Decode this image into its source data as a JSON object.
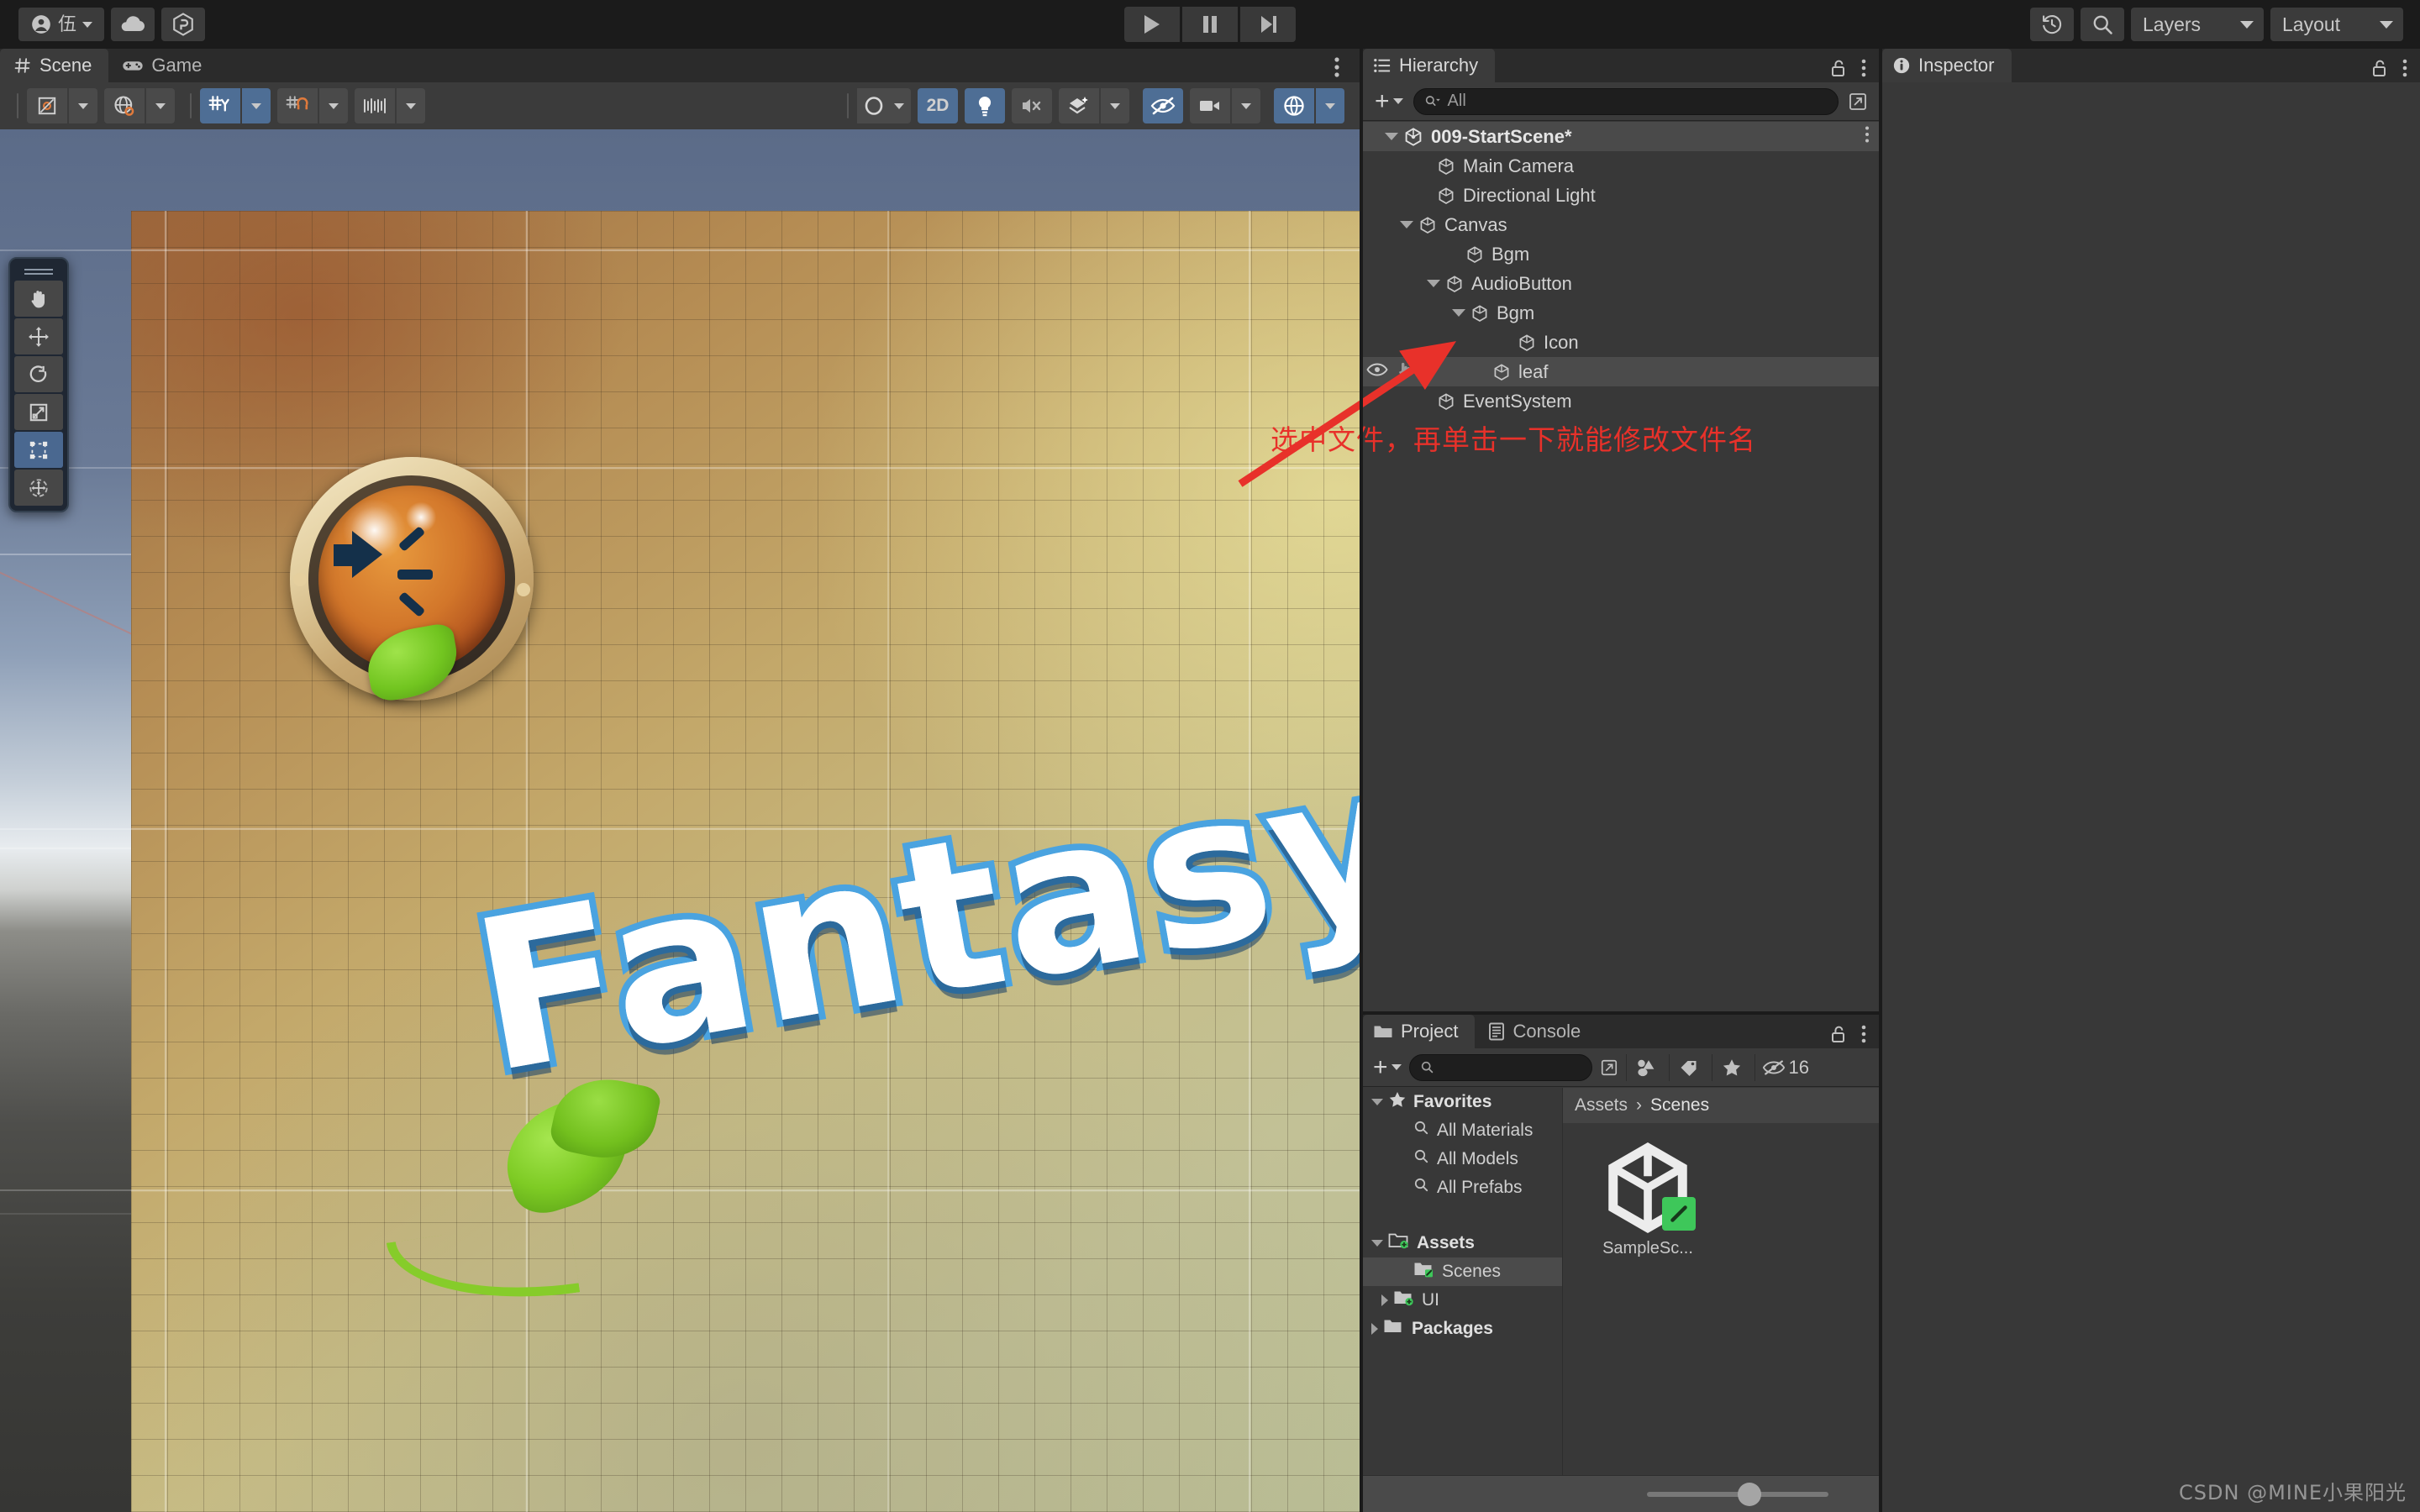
{
  "toolbar": {
    "account_label": "伍",
    "account_icon": "user-circle-icon",
    "cloud_icon": "cloud-icon",
    "services_icon": "unity-services-icon",
    "play_icon": "play-icon",
    "pause_icon": "pause-icon",
    "step_icon": "step-forward-icon",
    "history_icon": "undo-history-icon",
    "search_icon": "search-icon",
    "layers_label": "Layers",
    "layout_label": "Layout"
  },
  "scene_panel": {
    "tabs": [
      {
        "label": "Scene",
        "icon": "grid-hash-icon",
        "active": true
      },
      {
        "label": "Game",
        "icon": "gamepad-icon",
        "active": false
      }
    ],
    "kebab_icon": "kebab-menu-icon",
    "toolbar_left": [
      {
        "name": "pivot-mode",
        "icon": "pivot-center-icon",
        "dropdown": true,
        "active": false
      },
      {
        "name": "handle-space",
        "icon": "global-local-icon",
        "dropdown": true,
        "active": false
      }
    ],
    "toolbar_grid": [
      {
        "name": "grid-axis",
        "icon": "grid-y-icon",
        "dropdown": true,
        "active": true
      },
      {
        "name": "grid-snapping",
        "icon": "grid-snap-magnet-icon",
        "dropdown": true,
        "active": false
      },
      {
        "name": "snap-increment",
        "icon": "snap-ruler-icon",
        "dropdown": true,
        "active": false
      }
    ],
    "toolbar_right": [
      {
        "name": "shading-mode",
        "icon": "shaded-sphere-icon",
        "dropdown": true,
        "active": false
      },
      {
        "name": "2d-toggle",
        "label": "2D",
        "active": true
      },
      {
        "name": "scene-lighting",
        "icon": "lightbulb-icon",
        "active": true
      },
      {
        "name": "scene-audio",
        "icon": "speaker-mute-icon",
        "active": false
      },
      {
        "name": "effects",
        "icon": "fx-layers-icon",
        "dropdown": true,
        "active": false
      },
      {
        "name": "scene-visibility",
        "icon": "eye-off-icon",
        "active": true
      },
      {
        "name": "scene-camera",
        "icon": "camera-icon",
        "dropdown": true,
        "active": false
      },
      {
        "name": "gizmos",
        "icon": "gizmo-globe-icon",
        "dropdown": true,
        "active": true
      }
    ],
    "tool_palette": [
      {
        "name": "hand-tool",
        "icon": "hand-icon",
        "active": false
      },
      {
        "name": "move-tool",
        "icon": "move-arrows-icon",
        "active": false
      },
      {
        "name": "rotate-tool",
        "icon": "rotate-icon",
        "active": false
      },
      {
        "name": "scale-tool",
        "icon": "scale-icon",
        "active": false
      },
      {
        "name": "rect-tool",
        "icon": "rect-transform-icon",
        "active": true
      },
      {
        "name": "transform-tool",
        "icon": "transform-combined-icon",
        "active": false
      }
    ],
    "game_art": {
      "title_text": "Fantasy G",
      "audio_button": "audio-speaker-button-art",
      "leaf": "leaf-art"
    }
  },
  "hierarchy": {
    "tab_label": "Hierarchy",
    "tab_icon": "hierarchy-list-icon",
    "lock_icon": "lock-open-icon",
    "kebab_icon": "kebab-menu-icon",
    "add_label": "+",
    "search_placeholder": "All",
    "search_value": "",
    "search_icon": "search-dropdown-icon",
    "expand_icon": "open-in-new-icon",
    "items": [
      {
        "label": "009-StartScene*",
        "depth": 0,
        "icon": "unity-scene-icon",
        "expanded": true,
        "root": true,
        "selected": false,
        "kebab": true
      },
      {
        "label": "Main Camera",
        "depth": 1,
        "icon": "gameobject-cube-icon",
        "expanded": null,
        "selected": false
      },
      {
        "label": "Directional Light",
        "depth": 1,
        "icon": "gameobject-cube-icon",
        "expanded": null,
        "selected": false
      },
      {
        "label": "Canvas",
        "depth": 1,
        "icon": "gameobject-cube-icon",
        "expanded": true,
        "selected": false
      },
      {
        "label": "Bgm",
        "depth": 2,
        "icon": "gameobject-cube-icon",
        "expanded": null,
        "selected": false
      },
      {
        "label": "AudioButton",
        "depth": 2,
        "icon": "gameobject-cube-icon",
        "expanded": true,
        "selected": false
      },
      {
        "label": "Bgm",
        "depth": 3,
        "icon": "gameobject-cube-icon",
        "expanded": true,
        "selected": false
      },
      {
        "label": "Icon",
        "depth": 4,
        "icon": "gameobject-cube-icon",
        "expanded": null,
        "selected": false
      },
      {
        "label": "leaf",
        "depth": 3,
        "icon": "gameobject-cube-icon",
        "expanded": null,
        "selected": true,
        "visibility_icons": true
      },
      {
        "label": "EventSystem",
        "depth": 1,
        "icon": "gameobject-cube-icon",
        "expanded": null,
        "selected": false
      }
    ]
  },
  "inspector": {
    "tab_label": "Inspector",
    "tab_icon": "info-circle-icon",
    "lock_icon": "lock-open-icon",
    "kebab_icon": "kebab-menu-icon"
  },
  "project": {
    "tabs": [
      {
        "label": "Project",
        "icon": "folder-icon",
        "active": true
      },
      {
        "label": "Console",
        "icon": "console-lines-icon",
        "active": false
      }
    ],
    "lock_icon": "lock-open-icon",
    "kebab_icon": "kebab-menu-icon",
    "add_label": "+",
    "search_placeholder": "",
    "search_value": "",
    "search_icon": "search-icon",
    "expand_icon": "open-in-new-icon",
    "filter_buttons": [
      {
        "name": "filter-by-type",
        "icon": "asset-type-filter-icon"
      },
      {
        "name": "filter-by-label",
        "icon": "label-tag-icon"
      },
      {
        "name": "filter-favorites",
        "icon": "star-icon"
      }
    ],
    "hidden_count": "16",
    "hidden_icon": "eye-off-icon",
    "tree": [
      {
        "label": "Favorites",
        "depth": 0,
        "icon": "star-icon",
        "expanded": true,
        "bold": true,
        "selected": false
      },
      {
        "label": "All Materials",
        "depth": 1,
        "icon": "search-icon",
        "expanded": null,
        "bold": false,
        "selected": false
      },
      {
        "label": "All Models",
        "depth": 1,
        "icon": "search-icon",
        "expanded": null,
        "bold": false,
        "selected": false
      },
      {
        "label": "All Prefabs",
        "depth": 1,
        "icon": "search-icon",
        "expanded": null,
        "bold": false,
        "selected": false
      },
      {
        "label": "",
        "depth": 0,
        "icon": "spacer",
        "expanded": null,
        "bold": false,
        "selected": false
      },
      {
        "label": "Assets",
        "depth": 0,
        "icon": "folder-add-icon",
        "expanded": true,
        "bold": true,
        "selected": false
      },
      {
        "label": "Scenes",
        "depth": 1,
        "icon": "folder-check-icon",
        "expanded": null,
        "bold": false,
        "selected": true
      },
      {
        "label": "UI",
        "depth": 1,
        "icon": "folder-add-icon",
        "expanded": false,
        "bold": false,
        "selected": false
      },
      {
        "label": "Packages",
        "depth": 0,
        "icon": "folder-icon",
        "expanded": false,
        "bold": true,
        "selected": false
      }
    ],
    "breadcrumb": [
      "Assets",
      "Scenes"
    ],
    "breadcrumb_sep": "›",
    "assets": [
      {
        "label": "SampleSc...",
        "icon": "unity-scene-asset-icon",
        "badge": "edit-pencil-badge"
      }
    ],
    "zoom_slider_value": 50
  },
  "annotation": {
    "text": "选中文件，再单击一下就能修改文件名",
    "color": "#e8312a",
    "arrow": "red-arrow-pointing-up-right"
  },
  "watermark": {
    "text": "CSDN @MINE小果阳光"
  },
  "colors": {
    "window_bg": "#1b1b1b",
    "panel_bg": "#383838",
    "panel_header": "#2b2b2b",
    "toolbar_btn": "#3b3b3b",
    "accent_blue": "#4e6e95",
    "selection": "#4b4b4b",
    "tab_active_stripe": "#3a6ea5",
    "annotation_red": "#e8312a",
    "green_badge": "#3ec75a"
  }
}
